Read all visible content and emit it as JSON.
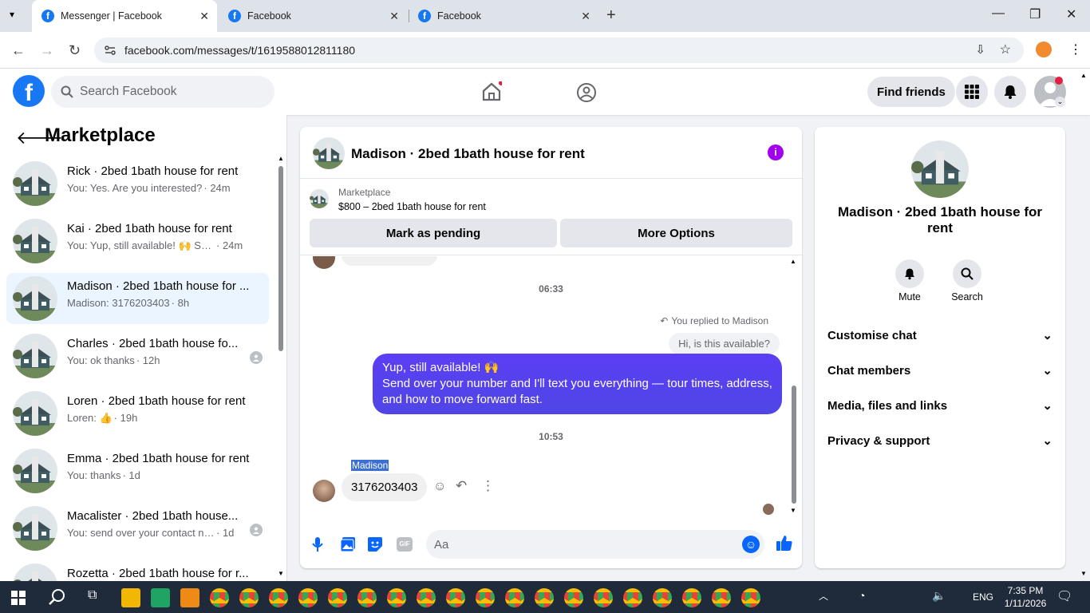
{
  "browser": {
    "tabs": [
      {
        "title": "Messenger | Facebook",
        "active": true
      },
      {
        "title": "Facebook",
        "active": false
      },
      {
        "title": "Facebook",
        "active": false
      }
    ],
    "url": "facebook.com/messages/t/1619588012811180"
  },
  "fb_header": {
    "search_placeholder": "Search Facebook",
    "find_friends": "Find friends"
  },
  "sidebar": {
    "title": "Marketplace",
    "conversations": [
      {
        "name": "Rick · 2bed 1bath house for rent",
        "snippet": "You: Yes. Are you interested?",
        "time": "· 24m"
      },
      {
        "name": "Kai · 2bed 1bath house for rent",
        "snippet": "You: Yup, still available! 🙌 Send ...",
        "time": "· 24m"
      },
      {
        "name": "Madison · 2bed 1bath house for ...",
        "snippet": "Madison: 3176203403",
        "time": "· 8h"
      },
      {
        "name": "Charles · 2bed 1bath house fo...",
        "snippet": "You: ok thanks",
        "time": "· 12h"
      },
      {
        "name": "Loren · 2bed 1bath house for rent",
        "snippet": "Loren: 👍",
        "time": "· 19h"
      },
      {
        "name": "Emma · 2bed 1bath house for rent",
        "snippet": "You: thanks",
        "time": "· 1d"
      },
      {
        "name": "Macalister · 2bed 1bath house...",
        "snippet": "You: send over your contact nu...",
        "time": "· 1d"
      },
      {
        "name": "Rozetta · 2bed 1bath house for r...",
        "snippet": "",
        "time": ""
      }
    ]
  },
  "chat": {
    "title": "Madison · 2bed 1bath house for rent",
    "marketplace_label": "Marketplace",
    "listing": "$800 – 2bed 1bath house for rent",
    "mark_pending": "Mark as pending",
    "more_options": "More Options",
    "time1": "06:33",
    "replied_to": "You replied to Madison",
    "quoted": "Hi, is this available?",
    "outgoing_line1": "Yup, still available! 🙌",
    "outgoing_line2": "Send over your number and I'll text you everything — tour times, address, and how to move forward fast.",
    "time2": "10:53",
    "sender": "Madison",
    "incoming": "3176203403",
    "input_placeholder": "Aa",
    "accent": "#5b3ef5"
  },
  "right_panel": {
    "name": "Madison · 2bed 1bath house for rent",
    "mute": "Mute",
    "search": "Search",
    "sections": [
      "Customise chat",
      "Chat members",
      "Media, files and links",
      "Privacy & support"
    ]
  },
  "taskbar": {
    "lang": "ENG",
    "time": "7:35 PM",
    "date": "1/11/2026"
  }
}
